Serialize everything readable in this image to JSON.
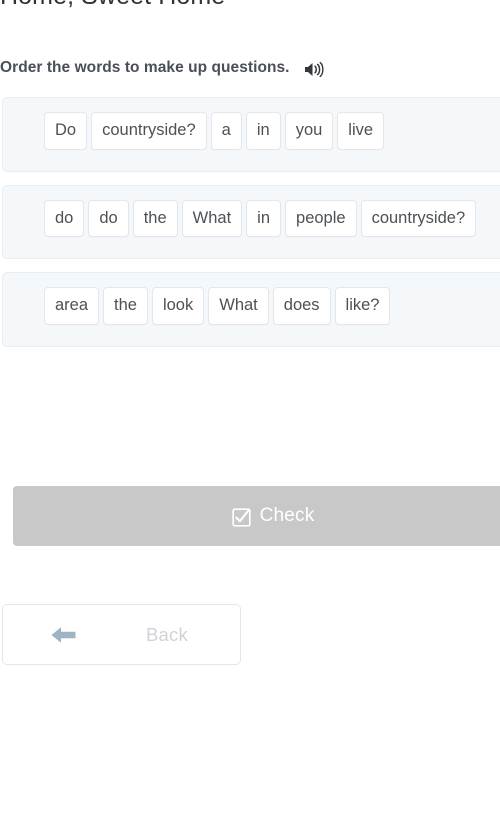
{
  "lesson": {
    "title": "Home, Sweet Home"
  },
  "instruction": {
    "text": "Order the words to make up questions.",
    "audio_icon": "speaker-icon"
  },
  "exercise": {
    "type": "word-order",
    "groups": [
      {
        "id": "question-1",
        "words": [
          "Do",
          "countryside?",
          "a",
          "in",
          "you",
          "live"
        ]
      },
      {
        "id": "question-2",
        "words": [
          "do",
          "do",
          "the",
          "What",
          "in",
          "people",
          "countryside?"
        ]
      },
      {
        "id": "question-3",
        "words": [
          "area",
          "the",
          "look",
          "What",
          "does",
          "like?"
        ]
      }
    ]
  },
  "actions": {
    "check": {
      "label": "Check",
      "icon": "checkbox-checked-icon",
      "state": "disabled",
      "bg_color": "#c8c8c8",
      "text_color": "#ffffff"
    },
    "back": {
      "label": "Back",
      "icon": "arrow-left-icon",
      "text_color": "#cfd4d8",
      "icon_color": "#9fb3c0"
    }
  },
  "theme": {
    "page_bg": "#ffffff",
    "panel_bg": "#f5f8fb",
    "panel_border": "#e6edf3",
    "chip_bg": "#ffffff",
    "chip_border": "#e3e6ea",
    "chip_text": "#4c5155",
    "instruction_text": "#4a4f57",
    "title_text": "#2f3338"
  }
}
